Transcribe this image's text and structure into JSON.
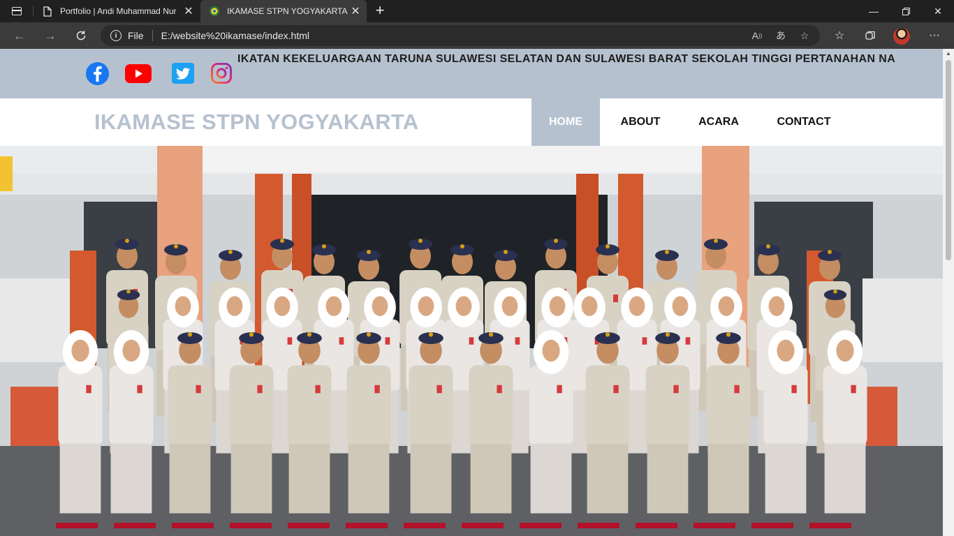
{
  "browser": {
    "tabs": [
      {
        "title": "Portfolio | Andi Muhammad Nur",
        "active": false
      },
      {
        "title": "IKAMASE STPN YOGYAKARTA",
        "active": true
      }
    ],
    "address": {
      "scheme": "File",
      "url": "E:/website%20ikamase/index.html"
    },
    "icons": {
      "back": "arrow-left-icon",
      "forward": "arrow-right-icon",
      "refresh": "refresh-icon",
      "read_aloud": "read-aloud-icon",
      "translate": "translate-icon",
      "add_favorite": "star-plus-icon",
      "favorites": "favorites-icon",
      "collections": "collections-icon",
      "menu": "more-dots-icon"
    }
  },
  "site": {
    "social": [
      "facebook-icon",
      "youtube-icon",
      "twitter-icon",
      "instagram-icon"
    ],
    "marquee": "IKATAN KEKELUARGAAN TARUNA SULAWESI SELATAN DAN SULAWESI BARAT SEKOLAH TINGGI PERTANAHAN NA",
    "brand": "IKAMASE STPN YOGYAKARTA",
    "nav": [
      {
        "label": "HOME",
        "active": true
      },
      {
        "label": "ABOUT",
        "active": false
      },
      {
        "label": "ACARA",
        "active": false
      },
      {
        "label": "CONTACT",
        "active": false
      }
    ],
    "colors": {
      "accent": "#b6c1cf",
      "topbar": "#b6c1cf",
      "nav_active_text": "#ffffff"
    }
  }
}
